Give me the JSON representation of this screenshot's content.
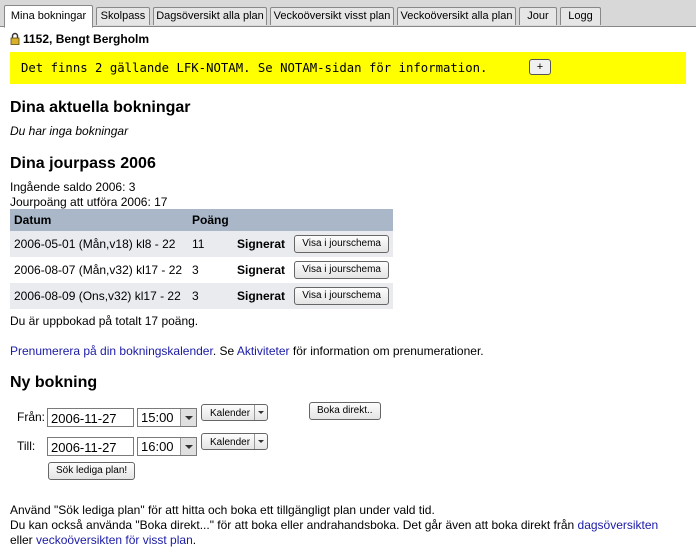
{
  "tabs": [
    "Mina bokningar",
    "Skolpass",
    "Dagsöversikt alla plan",
    "Veckoöversikt visst plan",
    "Veckoöversikt alla plan",
    "Jour",
    "Logg"
  ],
  "user": "1152, Bengt Bergholm",
  "notam": {
    "text": "Det finns 2 gällande LFK-NOTAM. Se NOTAM-sidan för information.",
    "button": "+"
  },
  "current": {
    "heading": "Dina aktuella bokningar",
    "empty": "Du har inga bokningar"
  },
  "jour": {
    "heading": "Dina jourpass 2006",
    "saldo": "Ingående saldo 2006: 3",
    "poang": "Jourpoäng att utföra 2006: 17",
    "col_datum": "Datum",
    "col_poang": "Poäng",
    "rows": [
      {
        "datum": "2006-05-01 (Mån,v18) kl8 - 22",
        "poang": "11",
        "status": "Signerat",
        "action": "Visa i jourschema"
      },
      {
        "datum": "2006-08-07 (Mån,v32) kl17 - 22",
        "poang": "3",
        "status": "Signerat",
        "action": "Visa i jourschema"
      },
      {
        "datum": "2006-08-09 (Ons,v32) kl17 - 22",
        "poang": "3",
        "status": "Signerat",
        "action": "Visa i jourschema"
      }
    ],
    "total": "Du är uppbokad på totalt 17 poäng."
  },
  "subscribe": {
    "link1": "Prenumerera på din bokningskalender",
    "mid": ". Se ",
    "link2": "Aktiviteter",
    "end": " för information om prenumerationer."
  },
  "ny": {
    "heading": "Ny bokning",
    "fran_label": "Från:",
    "fran_date": "2006-11-27",
    "fran_time": "15:00",
    "till_label": "Till:",
    "till_date": "2006-11-27",
    "till_time": "16:00",
    "kalender": "Kalender",
    "boka_direkt": "Boka direkt..",
    "sok": "Sök lediga plan!"
  },
  "footer": {
    "line1": "Använd \"Sök lediga plan\" för att hitta och boka ett tillgängligt plan under vald tid.",
    "line2_text": "Du kan också använda \"Boka direkt...\" för att boka eller andrahandsboka. Det går även att boka direkt från ",
    "line2_link": "dagsöversikten",
    "line3_pre": "eller ",
    "line3_link": "veckoöversikten för visst plan",
    "line3_end": "."
  }
}
